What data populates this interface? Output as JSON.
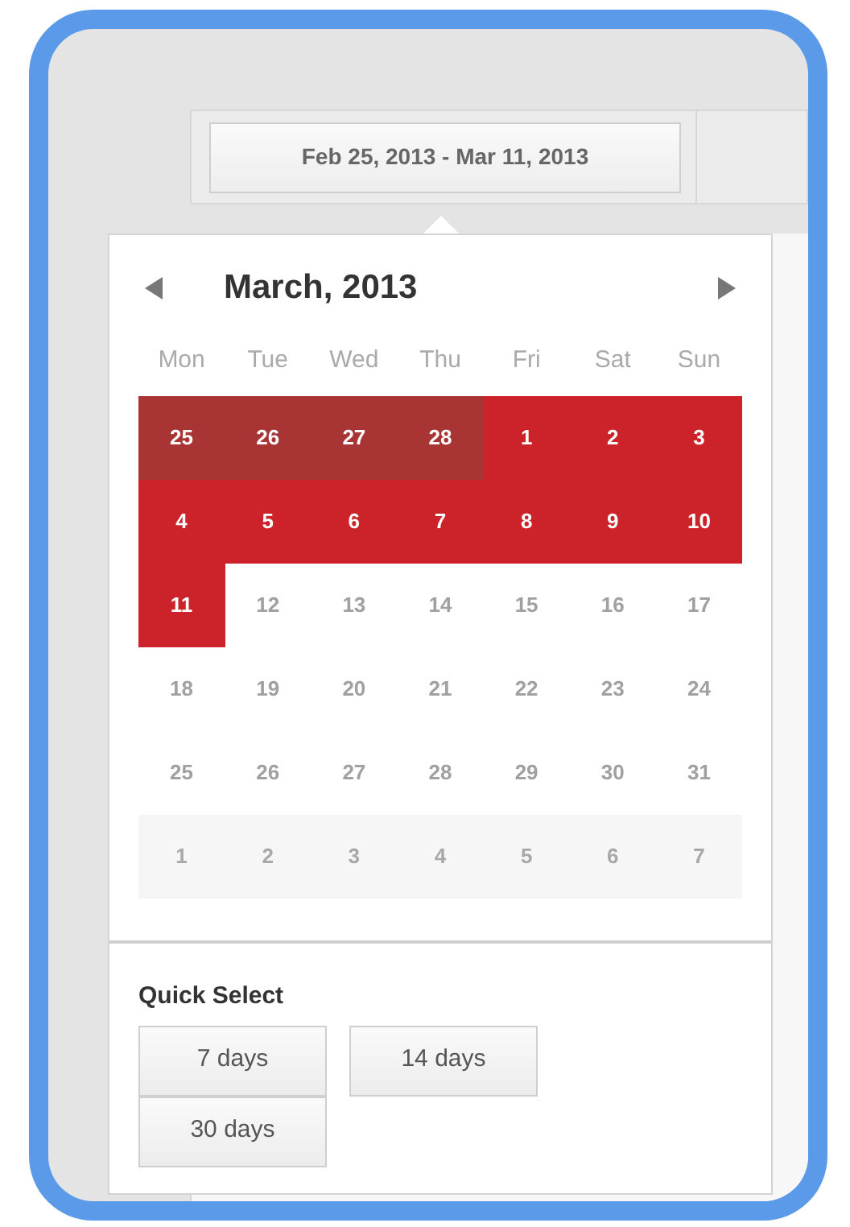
{
  "date_range_button": {
    "label": "Feb 25, 2013 - Mar 11, 2013"
  },
  "calendar": {
    "month_title": "March, 2013",
    "weekdays": [
      "Mon",
      "Tue",
      "Wed",
      "Thu",
      "Fri",
      "Sat",
      "Sun"
    ],
    "days": [
      {
        "label": "25",
        "kind": "other",
        "selected": true
      },
      {
        "label": "26",
        "kind": "other",
        "selected": true
      },
      {
        "label": "27",
        "kind": "other",
        "selected": true
      },
      {
        "label": "28",
        "kind": "other",
        "selected": true
      },
      {
        "label": "1",
        "kind": "current",
        "selected": true
      },
      {
        "label": "2",
        "kind": "current",
        "selected": true
      },
      {
        "label": "3",
        "kind": "current",
        "selected": true
      },
      {
        "label": "4",
        "kind": "current",
        "selected": true
      },
      {
        "label": "5",
        "kind": "current",
        "selected": true
      },
      {
        "label": "6",
        "kind": "current",
        "selected": true
      },
      {
        "label": "7",
        "kind": "current",
        "selected": true
      },
      {
        "label": "8",
        "kind": "current",
        "selected": true
      },
      {
        "label": "9",
        "kind": "current",
        "selected": true
      },
      {
        "label": "10",
        "kind": "current",
        "selected": true
      },
      {
        "label": "11",
        "kind": "current",
        "selected": true
      },
      {
        "label": "12",
        "kind": "current",
        "selected": false
      },
      {
        "label": "13",
        "kind": "current",
        "selected": false
      },
      {
        "label": "14",
        "kind": "current",
        "selected": false
      },
      {
        "label": "15",
        "kind": "current",
        "selected": false
      },
      {
        "label": "16",
        "kind": "current",
        "selected": false
      },
      {
        "label": "17",
        "kind": "current",
        "selected": false
      },
      {
        "label": "18",
        "kind": "current",
        "selected": false
      },
      {
        "label": "19",
        "kind": "current",
        "selected": false
      },
      {
        "label": "20",
        "kind": "current",
        "selected": false
      },
      {
        "label": "21",
        "kind": "current",
        "selected": false
      },
      {
        "label": "22",
        "kind": "current",
        "selected": false
      },
      {
        "label": "23",
        "kind": "current",
        "selected": false
      },
      {
        "label": "24",
        "kind": "current",
        "selected": false
      },
      {
        "label": "25",
        "kind": "current",
        "selected": false
      },
      {
        "label": "26",
        "kind": "current",
        "selected": false
      },
      {
        "label": "27",
        "kind": "current",
        "selected": false
      },
      {
        "label": "28",
        "kind": "current",
        "selected": false
      },
      {
        "label": "29",
        "kind": "current",
        "selected": false
      },
      {
        "label": "30",
        "kind": "current",
        "selected": false
      },
      {
        "label": "31",
        "kind": "current",
        "selected": false
      },
      {
        "label": "1",
        "kind": "other",
        "selected": false
      },
      {
        "label": "2",
        "kind": "other",
        "selected": false
      },
      {
        "label": "3",
        "kind": "other",
        "selected": false
      },
      {
        "label": "4",
        "kind": "other",
        "selected": false
      },
      {
        "label": "5",
        "kind": "other",
        "selected": false
      },
      {
        "label": "6",
        "kind": "other",
        "selected": false
      },
      {
        "label": "7",
        "kind": "other",
        "selected": false
      }
    ]
  },
  "quick_select": {
    "title": "Quick Select",
    "buttons": [
      "7 days",
      "14 days",
      "30 days"
    ]
  }
}
